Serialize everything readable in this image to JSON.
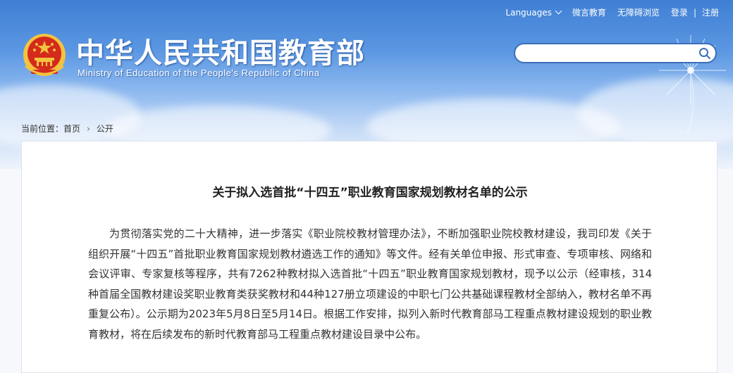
{
  "top_nav": {
    "languages": "Languages",
    "weibo": "微言教育",
    "accessibility": "无障碍浏览",
    "login": "登录",
    "separator": "|",
    "register": "注册"
  },
  "site": {
    "title_cn": "中华人民共和国教育部",
    "title_en": "Ministry of Education of the People's Republic of China"
  },
  "search": {
    "value": "",
    "placeholder": ""
  },
  "breadcrumb": {
    "label": "当前位置：",
    "home": "首页",
    "separator": "›",
    "current": "公开"
  },
  "article": {
    "title": "关于拟入选首批“十四五”职业教育国家规划教材名单的公示",
    "paragraph": "为贯彻落实党的二十大精神，进一步落实《职业院校教材管理办法》，不断加强职业院校教材建设，我司印发《关于组织开展“十四五”首批职业教育国家规划教材遴选工作的通知》等文件。经有关单位申报、形式审查、专项审核、网络和会议评审、专家复核等程序，共有7262种教材拟入选首批“十四五”职业教育国家规划教材，现予以公示（经审核，314种首届全国教材建设奖职业教育类获奖教材和44种127册立项建设的中职七门公共基础课程教材全部纳入，教材名单不再重复公布）。公示期为2023年5月8日至5月14日。根据工作安排，拟列入新时代教育部马工程重点教材建设规划的职业教育教材，将在后续发布的新时代教育部马工程重点教材建设目录中公布。"
  },
  "colors": {
    "header_blue": "#3f7fd4",
    "search_border": "#3c6fb8",
    "emblem_red": "#d42a1c",
    "emblem_gold": "#f3c340"
  }
}
